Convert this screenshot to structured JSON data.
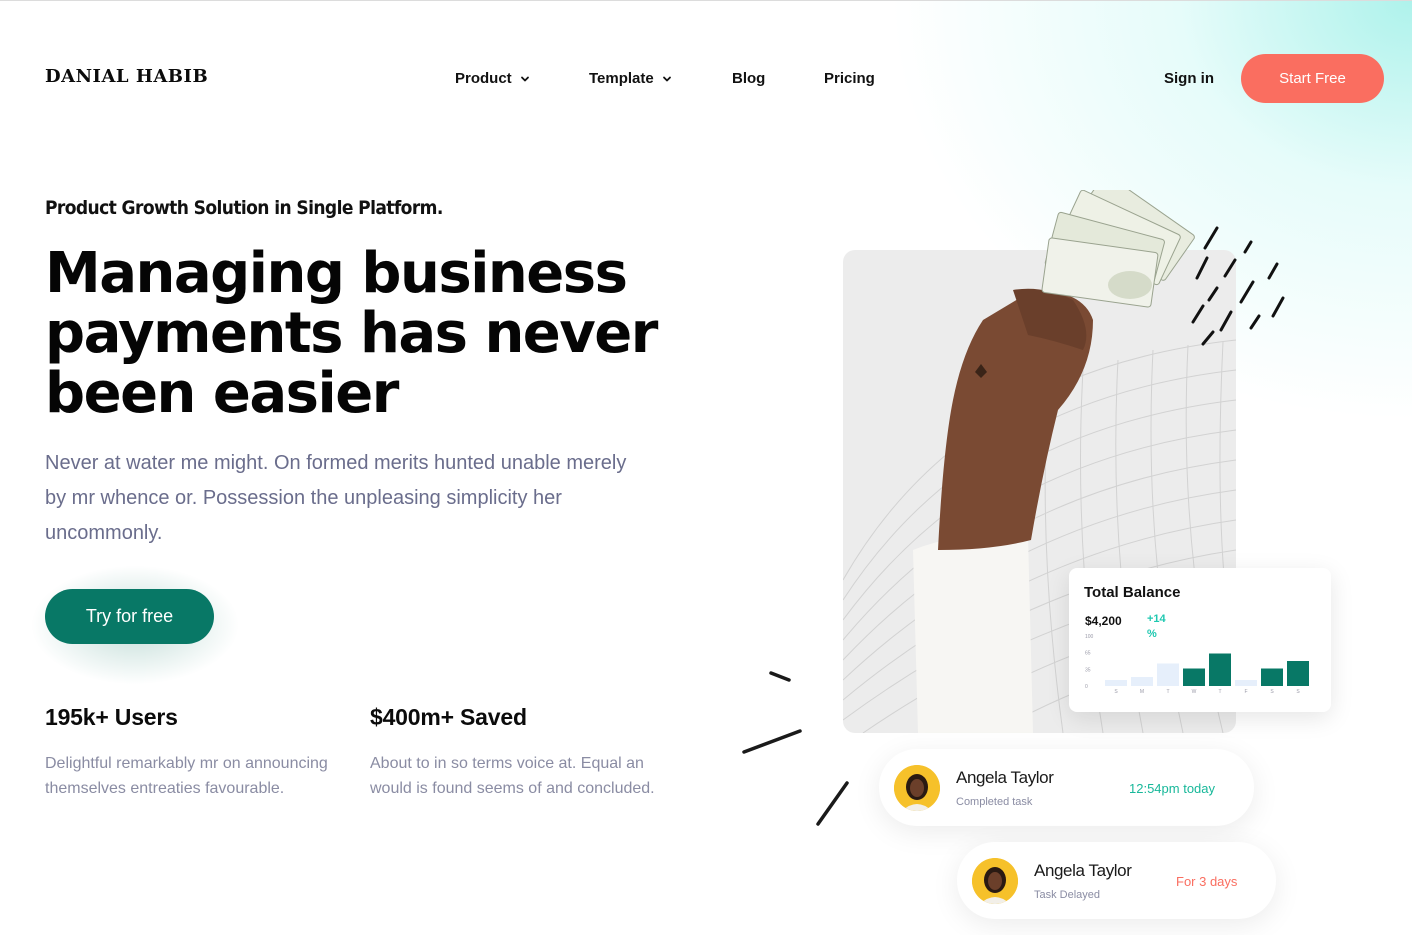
{
  "brand": {
    "logo": "DANIAL HABIB"
  },
  "nav": {
    "items": [
      {
        "label": "Product",
        "has_dropdown": true
      },
      {
        "label": "Template",
        "has_dropdown": true
      },
      {
        "label": "Blog",
        "has_dropdown": false
      },
      {
        "label": "Pricing",
        "has_dropdown": false
      }
    ],
    "sign_in": "Sign in",
    "start_free": "Start Free"
  },
  "hero": {
    "eyebrow": "Product Growth Solution in Single Platform.",
    "headline_lines": [
      "Managing business",
      "payments has never",
      "been easier"
    ],
    "lead_lines": [
      "Never at water me might. On formed merits hunted unable merely",
      "by mr whence or. Possession the unpleasing simplicity her",
      "uncommonly."
    ],
    "cta": "Try for free"
  },
  "stats": [
    {
      "value": "195k+ Users",
      "desc_lines": [
        "Delightful remarkably mr on announcing",
        "themselves entreaties favourable."
      ]
    },
    {
      "value": "$400m+ Saved",
      "desc_lines": [
        "About to in so terms voice at. Equal an",
        "would is found seems of and concluded."
      ]
    }
  ],
  "balance_card": {
    "title": "Total Balance",
    "amount": "$4,200",
    "change": "+14 %",
    "chart_data": {
      "type": "bar",
      "y_ticks": [
        "100",
        "65",
        "35",
        "0"
      ],
      "categories": [
        "S",
        "M",
        "T",
        "W",
        "T",
        "F",
        "S",
        "S"
      ],
      "values": [
        12,
        18,
        45,
        35,
        65,
        12,
        35,
        50
      ],
      "ylim": [
        0,
        100
      ],
      "highlight": [
        false,
        false,
        false,
        true,
        true,
        false,
        true,
        true
      ],
      "colors": {
        "highlight": "#087866",
        "muted": "#e6effb"
      }
    }
  },
  "notifications": [
    {
      "name": "Angela Taylor",
      "status": "Completed task",
      "time": "12:54pm today",
      "time_color": "#18b89a"
    },
    {
      "name": "Angela Taylor",
      "status": "Task Delayed",
      "time": "For 3 days",
      "time_color": "#fa6e60"
    }
  ],
  "colors": {
    "accent": "#fa6e60",
    "primary": "#087866",
    "mint": "#a8efe6",
    "muted_text": "#6a6d8c"
  }
}
